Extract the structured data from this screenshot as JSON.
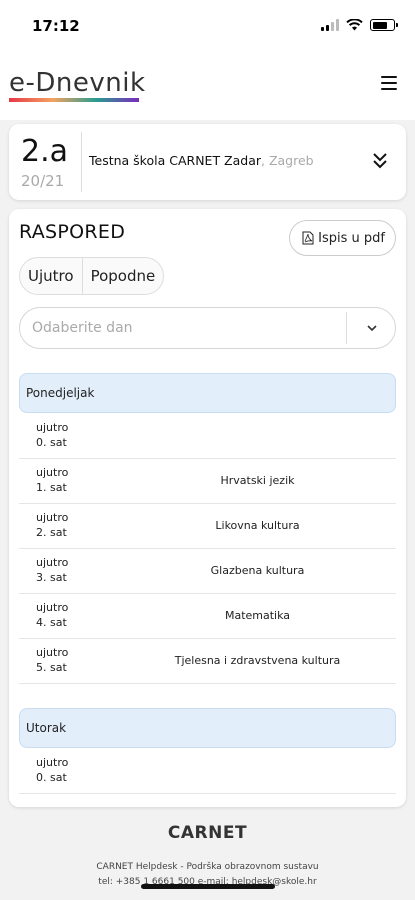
{
  "status": {
    "time": "17:12"
  },
  "header": {
    "logo": "e-Dnevnik"
  },
  "class_card": {
    "class_name": "2.a",
    "year": "20/21",
    "school": "Testna škola CARNET Zadar",
    "city": ", Zagreb"
  },
  "schedule": {
    "title": "RASPORED",
    "pdf_label": "Ispis u pdf",
    "shift_tabs": [
      "Ujutro",
      "Popodne"
    ],
    "day_select_placeholder": "Odaberite dan",
    "days": [
      {
        "name": "Ponedjeljak",
        "rows": [
          {
            "shift": "ujutro",
            "period": "0. sat",
            "subject": ""
          },
          {
            "shift": "ujutro",
            "period": "1. sat",
            "subject": "Hrvatski jezik"
          },
          {
            "shift": "ujutro",
            "period": "2. sat",
            "subject": "Likovna kultura"
          },
          {
            "shift": "ujutro",
            "period": "3. sat",
            "subject": "Glazbena kultura"
          },
          {
            "shift": "ujutro",
            "period": "4. sat",
            "subject": "Matematika"
          },
          {
            "shift": "ujutro",
            "period": "5. sat",
            "subject": "Tjelesna i zdravstvena kultura"
          }
        ]
      },
      {
        "name": "Utorak",
        "rows": [
          {
            "shift": "ujutro",
            "period": "0. sat",
            "subject": ""
          }
        ]
      }
    ]
  },
  "footer": {
    "brand": "CARNET",
    "line1": "CARNET Helpdesk - Podrška obrazovnom sustavu",
    "line2": "tel: +385 1 6661 500 e-mail: helpdesk@skole.hr"
  }
}
